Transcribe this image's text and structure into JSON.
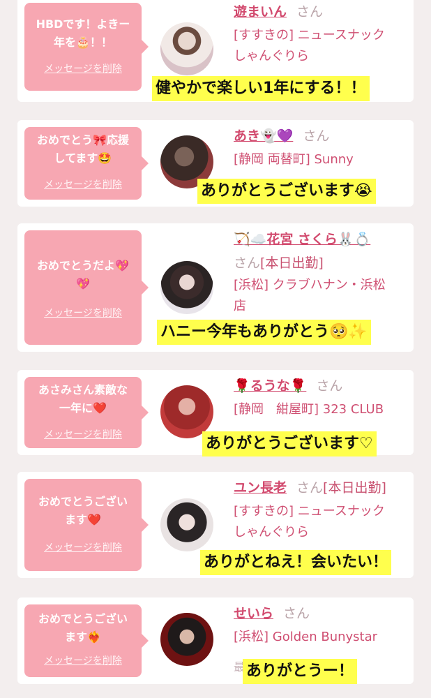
{
  "cards": [
    {
      "message_lines": [
        "HBDです！よきー",
        "年を🎂！！"
      ],
      "delete_label": "メッセージを削除",
      "name": "遊まいん",
      "suffix": "さん",
      "shop_lines": [
        "[すすきの] ニュースナック",
        "しゃんぐりら"
      ],
      "reply": "健やかで楽しい1年にする！！"
    },
    {
      "message_lines": [
        "おめでとう🎀応援",
        "してます🤩"
      ],
      "delete_label": "メッセージを削除",
      "name": "あき👻💜",
      "suffix": "さん",
      "shop_lines": [
        "[静岡 両替町] Sunny"
      ],
      "reply": "ありがとうございます😭"
    },
    {
      "message_lines": [
        "おめでとうだよ💖",
        "💖"
      ],
      "delete_label": "メッセージを削除",
      "name": "🏹☁️花宮 さくら🐰💍",
      "suffix": "さん",
      "status": "[本日出勤]",
      "shop_lines": [
        "[浜松] クラブハナン・浜松",
        "店"
      ],
      "reply": "ハニー今年もありがとう🥺✨"
    },
    {
      "message_lines": [
        "あさみさん素敵な",
        "一年に❤️"
      ],
      "delete_label": "メッセージを削除",
      "name": "🌹るうな🌹",
      "suffix": "さん",
      "shop_lines": [
        "[静岡　紺屋町] 323 CLUB"
      ],
      "reply": "ありがとうございます♡"
    },
    {
      "message_lines": [
        "おめでとうござい",
        "ます❤️"
      ],
      "delete_label": "メッセージを削除",
      "name": "ユン長老",
      "suffix": "さん",
      "status": "[本日出勤]",
      "shop_lines": [
        "[すすきの] ニュースナック",
        "しゃんぐりら"
      ],
      "reply": "ありがとねえ！会いたい！"
    },
    {
      "message_lines": [
        "おめでとうござい",
        "ます❤️‍🔥"
      ],
      "delete_label": "メッセージを削除",
      "name": "せいら",
      "suffix": "さん",
      "shop_lines": [
        "[浜松] Golden Bunystar"
      ],
      "reply": "ありがとうー！"
    }
  ]
}
